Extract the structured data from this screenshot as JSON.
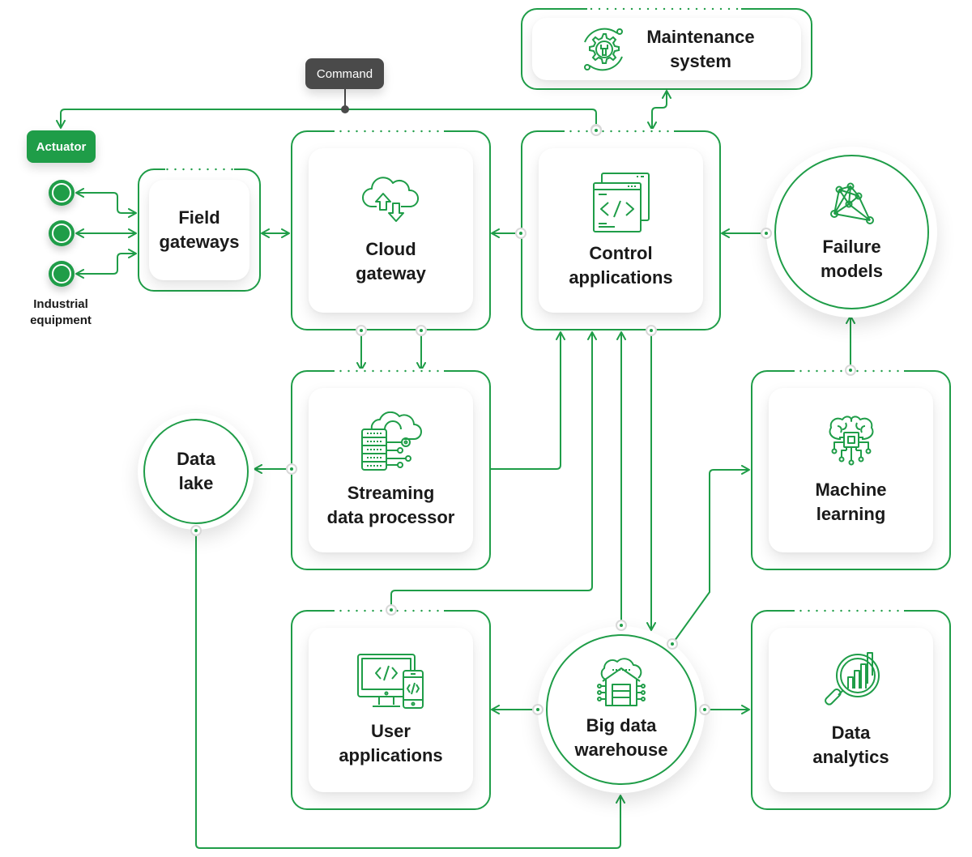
{
  "colors": {
    "accent": "#1f9d48",
    "text": "#1a1a1a",
    "command_bg": "#4a4a4a",
    "port_ring": "#d8d8d8"
  },
  "labels": {
    "command": "Command",
    "actuator": "Actuator",
    "industrial_equipment": "Industrial\nequipment"
  },
  "nodes": {
    "maintenance_system": {
      "title": "Maintenance\nsystem",
      "icon": "gear-wrench-icon"
    },
    "field_gateways": {
      "title": "Field\ngateways"
    },
    "cloud_gateway": {
      "title": "Cloud\ngateway",
      "icon": "cloud-upload-download-icon"
    },
    "control_applications": {
      "title": "Control\napplications",
      "icon": "code-window-icon"
    },
    "failure_models": {
      "title": "Failure\nmodels",
      "icon": "network-graph-icon"
    },
    "data_lake": {
      "title": "Data\nlake"
    },
    "streaming_data_processor": {
      "title": "Streaming\ndata processor",
      "icon": "server-cloud-icon"
    },
    "machine_learning": {
      "title": "Machine\nlearning",
      "icon": "brain-chip-icon"
    },
    "user_applications": {
      "title": "User\napplications",
      "icon": "desktop-mobile-code-icon"
    },
    "big_data_warehouse": {
      "title": "Big data\nwarehouse",
      "icon": "cloud-warehouse-icon"
    },
    "data_analytics": {
      "title": "Data\nanalytics",
      "icon": "magnifier-chart-icon"
    }
  },
  "edges": [
    {
      "from": "control_applications",
      "to": "actuator",
      "label": "Command"
    },
    {
      "from": "control_applications",
      "to": "maintenance_system",
      "bidirectional": true
    },
    {
      "from": "industrial_equipment",
      "to": "field_gateways",
      "bidirectional": true
    },
    {
      "from": "field_gateways",
      "to": "cloud_gateway",
      "bidirectional": true
    },
    {
      "from": "control_applications",
      "to": "cloud_gateway"
    },
    {
      "from": "failure_models",
      "to": "control_applications"
    },
    {
      "from": "cloud_gateway",
      "to": "streaming_data_processor"
    },
    {
      "from": "streaming_data_processor",
      "to": "data_lake"
    },
    {
      "from": "streaming_data_processor",
      "to": "control_applications"
    },
    {
      "from": "user_applications",
      "to": "control_applications"
    },
    {
      "from": "big_data_warehouse",
      "to": "control_applications"
    },
    {
      "from": "control_applications",
      "to": "big_data_warehouse"
    },
    {
      "from": "big_data_warehouse",
      "to": "machine_learning"
    },
    {
      "from": "machine_learning",
      "to": "failure_models"
    },
    {
      "from": "big_data_warehouse",
      "to": "user_applications"
    },
    {
      "from": "big_data_warehouse",
      "to": "data_analytics"
    },
    {
      "from": "data_lake",
      "to": "big_data_warehouse"
    }
  ]
}
